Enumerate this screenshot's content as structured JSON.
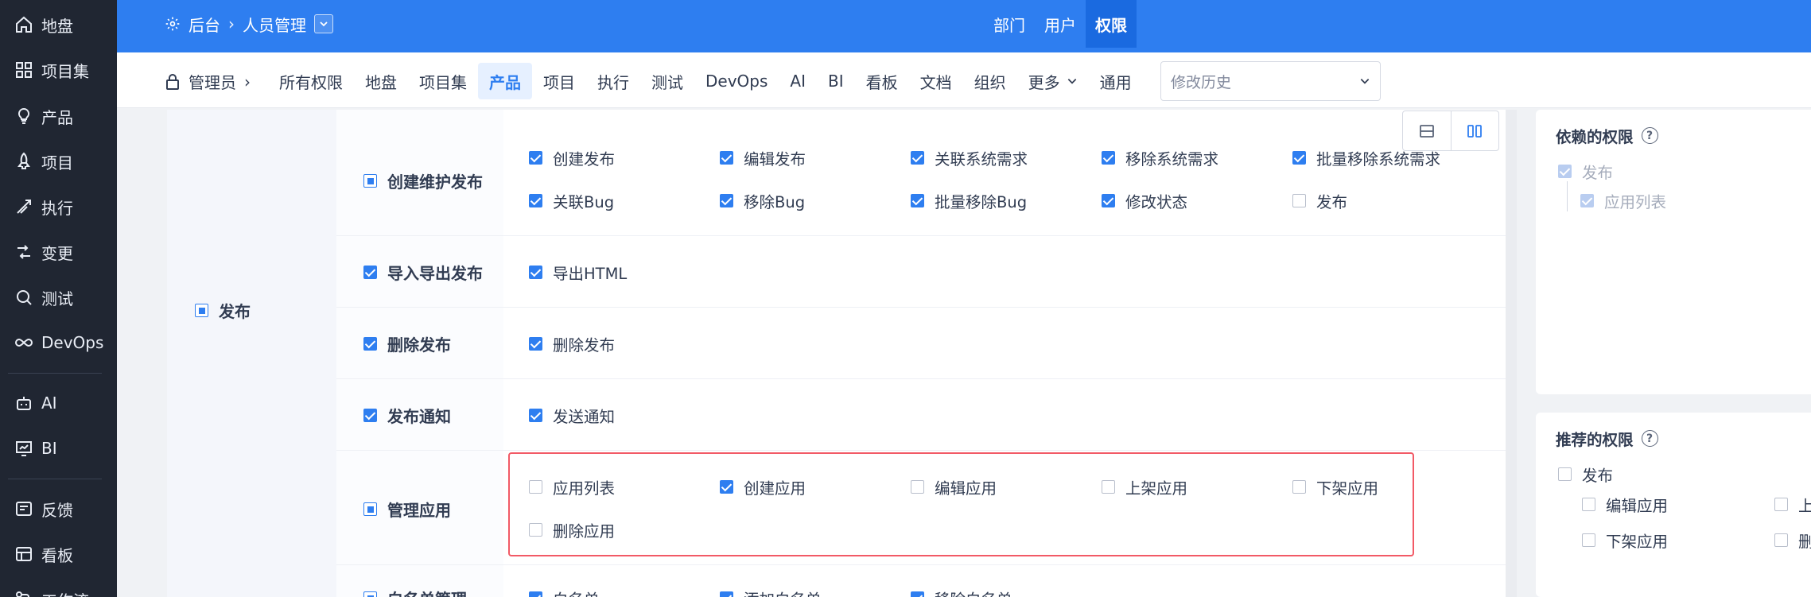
{
  "sidebar": {
    "items": [
      {
        "label": "地盘",
        "icon": "home-icon"
      },
      {
        "label": "项目集",
        "icon": "grid-icon"
      },
      {
        "label": "产品",
        "icon": "lightbulb-icon"
      },
      {
        "label": "项目",
        "icon": "rocket-icon"
      },
      {
        "label": "执行",
        "icon": "run-icon"
      },
      {
        "label": "变更",
        "icon": "change-icon"
      },
      {
        "label": "测试",
        "icon": "test-icon"
      },
      {
        "label": "DevOps",
        "icon": "infinity-icon"
      },
      {
        "label": "AI",
        "icon": "robot-icon"
      },
      {
        "label": "BI",
        "icon": "chart-icon"
      },
      {
        "label": "反馈",
        "icon": "feedback-icon"
      },
      {
        "label": "看板",
        "icon": "kanban-icon"
      },
      {
        "label": "工作流",
        "icon": "workflow-icon"
      }
    ]
  },
  "topbar": {
    "home": "后台",
    "section": "人员管理",
    "nav": [
      "部门",
      "用户",
      "权限"
    ],
    "active_nav": "权限"
  },
  "subbar": {
    "group": "管理员",
    "tabs": [
      "所有权限",
      "地盘",
      "项目集",
      "产品",
      "项目",
      "执行",
      "测试",
      "DevOps",
      "AI",
      "BI",
      "看板",
      "文档",
      "组织",
      "更多",
      "通用"
    ],
    "active_tab": "产品",
    "history_placeholder": "修改历史"
  },
  "permissions": {
    "group_label": "发布",
    "rows": [
      {
        "name": "创建维护发布",
        "state": "half",
        "items": [
          {
            "label": "创建发布",
            "checked": true
          },
          {
            "label": "编辑发布",
            "checked": true
          },
          {
            "label": "关联系统需求",
            "checked": true
          },
          {
            "label": "移除系统需求",
            "checked": true
          },
          {
            "label": "批量移除系统需求",
            "checked": true
          },
          {
            "label": "关联Bug",
            "checked": true
          },
          {
            "label": "移除Bug",
            "checked": true
          },
          {
            "label": "批量移除Bug",
            "checked": true
          },
          {
            "label": "修改状态",
            "checked": true
          },
          {
            "label": "发布",
            "checked": false
          }
        ]
      },
      {
        "name": "导入导出发布",
        "state": "on",
        "items": [
          {
            "label": "导出HTML",
            "checked": true
          }
        ]
      },
      {
        "name": "删除发布",
        "state": "on",
        "items": [
          {
            "label": "删除发布",
            "checked": true
          }
        ]
      },
      {
        "name": "发布通知",
        "state": "on",
        "items": [
          {
            "label": "发送通知",
            "checked": true
          }
        ]
      },
      {
        "name": "管理应用",
        "state": "half",
        "items": [
          {
            "label": "应用列表",
            "checked": false
          },
          {
            "label": "创建应用",
            "checked": true
          },
          {
            "label": "编辑应用",
            "checked": false
          },
          {
            "label": "上架应用",
            "checked": false
          },
          {
            "label": "下架应用",
            "checked": false
          },
          {
            "label": "删除应用",
            "checked": false
          }
        ]
      },
      {
        "name": "白名单管理",
        "state": "half",
        "items": [
          {
            "label": "白名单",
            "checked": true
          },
          {
            "label": "添加白名单",
            "checked": true
          },
          {
            "label": "移除白名单",
            "checked": true
          }
        ]
      }
    ]
  },
  "depend_panel": {
    "title": "依赖的权限",
    "items": [
      "发布",
      "应用列表"
    ]
  },
  "recommend_panel": {
    "title": "推荐的权限",
    "root": "发布",
    "items": [
      "编辑应用",
      "上架应用",
      "下架应用",
      "删除应用"
    ]
  },
  "colors": {
    "accent": "#2e7ef0",
    "sidebar_bg": "#202632",
    "highlight_border": "#f25a66"
  }
}
